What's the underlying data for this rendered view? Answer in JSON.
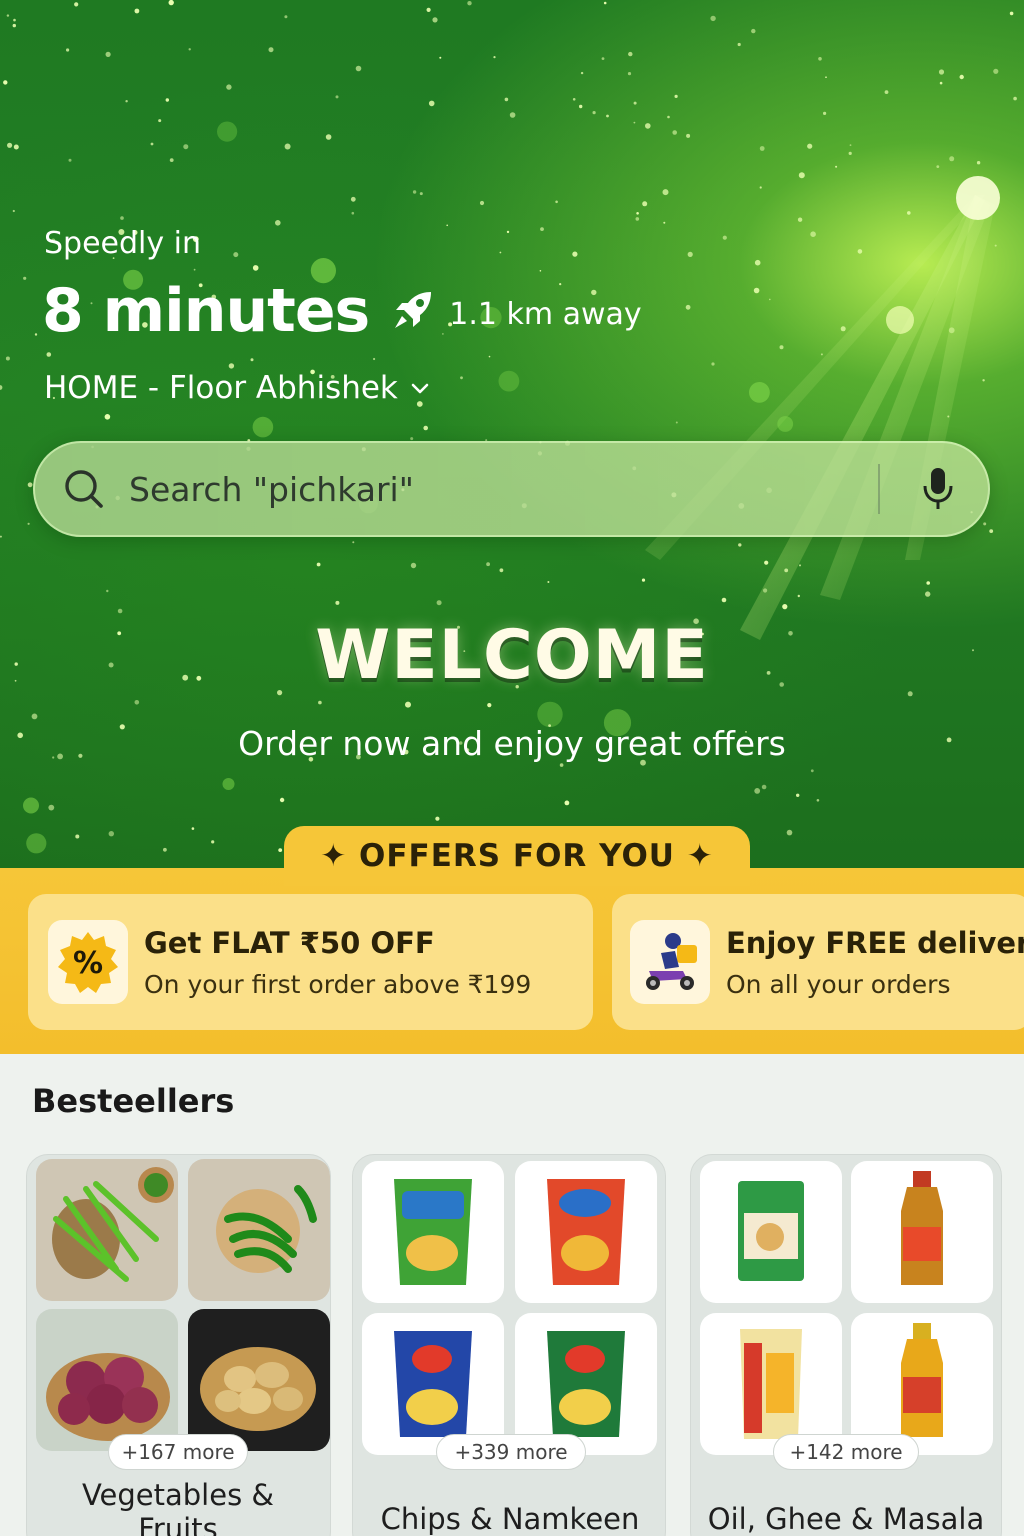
{
  "header": {
    "speedly_label": "Speedly in",
    "eta": "8 minutes",
    "distance": "1.1 km away",
    "address": "HOME - Floor Abhishek"
  },
  "search": {
    "placeholder": "Search \"pichkari\""
  },
  "welcome": {
    "title": "WELCOME",
    "subtitle": "Order now and enjoy great offers"
  },
  "offers": {
    "heading": "✦ OFFERS FOR YOU ✦",
    "items": [
      {
        "icon": "percent-badge-icon",
        "title": "Get FLAT ₹50 OFF",
        "subtitle": "On your first order above ₹199"
      },
      {
        "icon": "delivery-scooter-icon",
        "title": "Enjoy FREE delivery",
        "subtitle": "On all your orders"
      }
    ]
  },
  "bestsellers": {
    "title": "Besteellers",
    "categories": [
      {
        "name": "Vegetables & Fruits",
        "more": "+167 more"
      },
      {
        "name": "Chips & Namkeen",
        "more": "+339 more"
      },
      {
        "name": "Oil, Ghee & Masala",
        "more": "+142 more"
      }
    ]
  },
  "colors": {
    "hero_green": "#1f7a22",
    "offer_yellow": "#f6c638",
    "offer_card": "#fbe089"
  }
}
